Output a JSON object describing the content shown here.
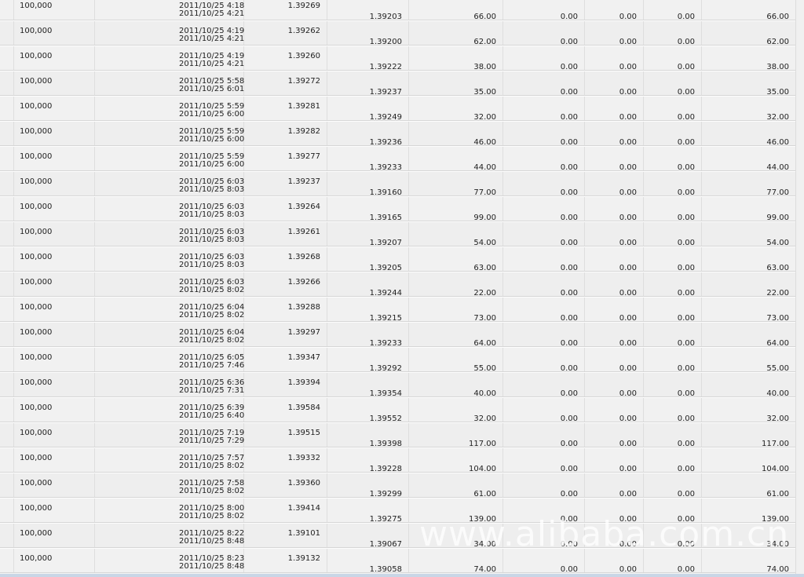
{
  "rows": [
    {
      "lots": "100,000",
      "open_time": "2011/10/25 4:18",
      "close_time": "2011/10/25 4:21",
      "open_price": "1.39269",
      "close_price": "1.39203",
      "pips": "66.00",
      "commission": "0.00",
      "swap": "0.00",
      "tax": "0.00",
      "profit": "66.00"
    },
    {
      "lots": "100,000",
      "open_time": "2011/10/25 4:19",
      "close_time": "2011/10/25 4:21",
      "open_price": "1.39262",
      "close_price": "1.39200",
      "pips": "62.00",
      "commission": "0.00",
      "swap": "0.00",
      "tax": "0.00",
      "profit": "62.00"
    },
    {
      "lots": "100,000",
      "open_time": "2011/10/25 4:19",
      "close_time": "2011/10/25 4:21",
      "open_price": "1.39260",
      "close_price": "1.39222",
      "pips": "38.00",
      "commission": "0.00",
      "swap": "0.00",
      "tax": "0.00",
      "profit": "38.00"
    },
    {
      "lots": "100,000",
      "open_time": "2011/10/25 5:58",
      "close_time": "2011/10/25 6:01",
      "open_price": "1.39272",
      "close_price": "1.39237",
      "pips": "35.00",
      "commission": "0.00",
      "swap": "0.00",
      "tax": "0.00",
      "profit": "35.00"
    },
    {
      "lots": "100,000",
      "open_time": "2011/10/25 5:59",
      "close_time": "2011/10/25 6:00",
      "open_price": "1.39281",
      "close_price": "1.39249",
      "pips": "32.00",
      "commission": "0.00",
      "swap": "0.00",
      "tax": "0.00",
      "profit": "32.00"
    },
    {
      "lots": "100,000",
      "open_time": "2011/10/25 5:59",
      "close_time": "2011/10/25 6:00",
      "open_price": "1.39282",
      "close_price": "1.39236",
      "pips": "46.00",
      "commission": "0.00",
      "swap": "0.00",
      "tax": "0.00",
      "profit": "46.00"
    },
    {
      "lots": "100,000",
      "open_time": "2011/10/25 5:59",
      "close_time": "2011/10/25 6:00",
      "open_price": "1.39277",
      "close_price": "1.39233",
      "pips": "44.00",
      "commission": "0.00",
      "swap": "0.00",
      "tax": "0.00",
      "profit": "44.00"
    },
    {
      "lots": "100,000",
      "open_time": "2011/10/25 6:03",
      "close_time": "2011/10/25 8:03",
      "open_price": "1.39237",
      "close_price": "1.39160",
      "pips": "77.00",
      "commission": "0.00",
      "swap": "0.00",
      "tax": "0.00",
      "profit": "77.00"
    },
    {
      "lots": "100,000",
      "open_time": "2011/10/25 6:03",
      "close_time": "2011/10/25 8:03",
      "open_price": "1.39264",
      "close_price": "1.39165",
      "pips": "99.00",
      "commission": "0.00",
      "swap": "0.00",
      "tax": "0.00",
      "profit": "99.00"
    },
    {
      "lots": "100,000",
      "open_time": "2011/10/25 6:03",
      "close_time": "2011/10/25 8:03",
      "open_price": "1.39261",
      "close_price": "1.39207",
      "pips": "54.00",
      "commission": "0.00",
      "swap": "0.00",
      "tax": "0.00",
      "profit": "54.00"
    },
    {
      "lots": "100,000",
      "open_time": "2011/10/25 6:03",
      "close_time": "2011/10/25 8:03",
      "open_price": "1.39268",
      "close_price": "1.39205",
      "pips": "63.00",
      "commission": "0.00",
      "swap": "0.00",
      "tax": "0.00",
      "profit": "63.00"
    },
    {
      "lots": "100,000",
      "open_time": "2011/10/25 6:03",
      "close_time": "2011/10/25 8:02",
      "open_price": "1.39266",
      "close_price": "1.39244",
      "pips": "22.00",
      "commission": "0.00",
      "swap": "0.00",
      "tax": "0.00",
      "profit": "22.00"
    },
    {
      "lots": "100,000",
      "open_time": "2011/10/25 6:04",
      "close_time": "2011/10/25 8:02",
      "open_price": "1.39288",
      "close_price": "1.39215",
      "pips": "73.00",
      "commission": "0.00",
      "swap": "0.00",
      "tax": "0.00",
      "profit": "73.00"
    },
    {
      "lots": "100,000",
      "open_time": "2011/10/25 6:04",
      "close_time": "2011/10/25 8:02",
      "open_price": "1.39297",
      "close_price": "1.39233",
      "pips": "64.00",
      "commission": "0.00",
      "swap": "0.00",
      "tax": "0.00",
      "profit": "64.00"
    },
    {
      "lots": "100,000",
      "open_time": "2011/10/25 6:05",
      "close_time": "2011/10/25 7:46",
      "open_price": "1.39347",
      "close_price": "1.39292",
      "pips": "55.00",
      "commission": "0.00",
      "swap": "0.00",
      "tax": "0.00",
      "profit": "55.00"
    },
    {
      "lots": "100,000",
      "open_time": "2011/10/25 6:36",
      "close_time": "2011/10/25 7:31",
      "open_price": "1.39394",
      "close_price": "1.39354",
      "pips": "40.00",
      "commission": "0.00",
      "swap": "0.00",
      "tax": "0.00",
      "profit": "40.00"
    },
    {
      "lots": "100,000",
      "open_time": "2011/10/25 6:39",
      "close_time": "2011/10/25 6:40",
      "open_price": "1.39584",
      "close_price": "1.39552",
      "pips": "32.00",
      "commission": "0.00",
      "swap": "0.00",
      "tax": "0.00",
      "profit": "32.00"
    },
    {
      "lots": "100,000",
      "open_time": "2011/10/25 7:19",
      "close_time": "2011/10/25 7:29",
      "open_price": "1.39515",
      "close_price": "1.39398",
      "pips": "117.00",
      "commission": "0.00",
      "swap": "0.00",
      "tax": "0.00",
      "profit": "117.00"
    },
    {
      "lots": "100,000",
      "open_time": "2011/10/25 7:57",
      "close_time": "2011/10/25 8:02",
      "open_price": "1.39332",
      "close_price": "1.39228",
      "pips": "104.00",
      "commission": "0.00",
      "swap": "0.00",
      "tax": "0.00",
      "profit": "104.00"
    },
    {
      "lots": "100,000",
      "open_time": "2011/10/25 7:58",
      "close_time": "2011/10/25 8:02",
      "open_price": "1.39360",
      "close_price": "1.39299",
      "pips": "61.00",
      "commission": "0.00",
      "swap": "0.00",
      "tax": "0.00",
      "profit": "61.00"
    },
    {
      "lots": "100,000",
      "open_time": "2011/10/25 8:00",
      "close_time": "2011/10/25 8:02",
      "open_price": "1.39414",
      "close_price": "1.39275",
      "pips": "139.00",
      "commission": "0.00",
      "swap": "0.00",
      "tax": "0.00",
      "profit": "139.00"
    },
    {
      "lots": "100,000",
      "open_time": "2011/10/25 8:22",
      "close_time": "2011/10/25 8:48",
      "open_price": "1.39101",
      "close_price": "1.39067",
      "pips": "34.00",
      "commission": "0.00",
      "swap": "0.00",
      "tax": "0.00",
      "profit": "34.00"
    },
    {
      "lots": "100,000",
      "open_time": "2011/10/25 8:23",
      "close_time": "2011/10/25 8:48",
      "open_price": "1.39132",
      "close_price": "1.39058",
      "pips": "74.00",
      "commission": "0.00",
      "swap": "0.00",
      "tax": "0.00",
      "profit": "74.00"
    }
  ],
  "watermark": "www.alibaba.com.cn",
  "colors": {
    "row": "#f1f1f1",
    "grid": "#dedede",
    "text": "#1e1e1e"
  }
}
